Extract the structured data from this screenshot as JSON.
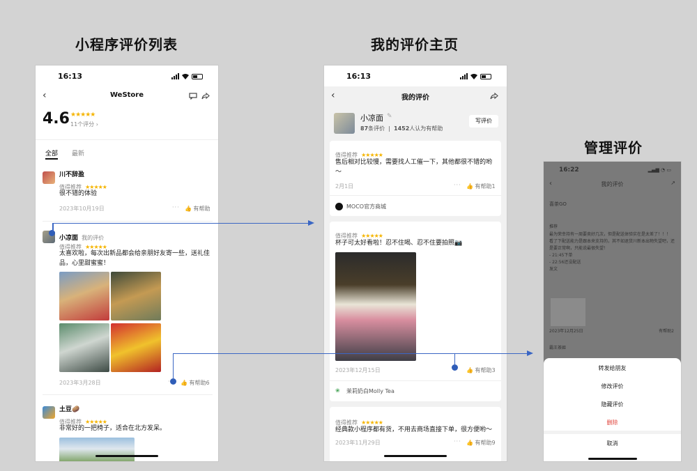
{
  "titles": {
    "list": "小程序评价列表",
    "home": "我的评价主页",
    "manage": "管理评价"
  },
  "statusbar": {
    "time1": "16:13",
    "time2": "16:13",
    "time3": "16:22"
  },
  "phone1": {
    "nav_title": "WeStore",
    "score": "4.6",
    "rating_count": "11个评分 ›",
    "tabs": [
      "全部",
      "最新"
    ],
    "reviews": [
      {
        "name": "川不辞盈",
        "tag": "值得推荐",
        "stars": "★★★★★",
        "text": "很不错的体验",
        "date": "2023年10月19日",
        "helpful": "有帮助"
      },
      {
        "name": "小凉面",
        "badge": "我的评价",
        "tag": "值得推荐",
        "stars": "★★★★★",
        "text": "太喜欢啦，每次出新品都会给亲朋好友寄一些，送礼佳品，心里甜蜜蜜！",
        "date": "2023年3月28日",
        "helpful": "有帮助6"
      },
      {
        "name": "土豆🥔",
        "tag": "值得推荐",
        "stars": "★★★★★",
        "text": "非常好的一把椅子，适合在北方发呆。"
      }
    ]
  },
  "phone2": {
    "nav_title": "我的评价",
    "profile": {
      "name": "小凉面",
      "reviews_num": "87",
      "reviews_label": "条评价",
      "helpful_num": "1452",
      "helpful_label": "人认为有帮助",
      "write_btn": "写评价"
    },
    "reviews": [
      {
        "tag": "值得推荐",
        "stars": "★★★★★",
        "text": "售后相对比较慢，需要找人工催一下，其他都很不错的哟～",
        "date": "2月1日",
        "helpful": "有帮助1",
        "store": "MOCO官方商城"
      },
      {
        "tag": "值得推荐",
        "stars": "★★★★★",
        "text": "杯子可太好看啦！忍不住喝、忍不住要拍照📷",
        "date": "2023年12月15日",
        "helpful": "有帮助3",
        "store": "茉莉奶白Molly Tea"
      },
      {
        "tag": "值得推荐",
        "stars": "★★★★★",
        "text": "经典款小程序都有货，不用去商场直接下单，很方便哟～",
        "date": "2023年11月29日",
        "helpful": "有帮助9"
      }
    ]
  },
  "phone3": {
    "nav_title": "我的评价",
    "bg_store_top": "喜茶GO",
    "bg_tag": "推荐",
    "bg_lines": [
      "最为荣幸持有一周要卖好几次，但是配送体验实在是太差了！！！",
      "看了下配送能力是跟本来支持的，其不如退货川新本出物失望吧，还是要正常啊，只能说最很失望！",
      "- 21:45下单",
      "- 22:56还没配送",
      "发文"
    ],
    "bg_date": "2023年12月25日",
    "bg_helpful": "有帮助2",
    "bg_store": "霸王茶姬",
    "sheet": [
      "转发给朋友",
      "修改评价",
      "隐藏评价",
      "删除",
      "取消"
    ]
  },
  "colors": {
    "accent_blue": "#3a66c4",
    "star": "#f5b400",
    "delete": "#e0443c"
  }
}
